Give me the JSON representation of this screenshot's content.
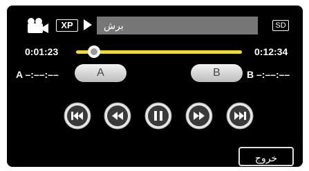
{
  "status": {
    "mode_icon": "video-camera-icon",
    "quality_badge": "XP",
    "play_icon": "play-icon",
    "title": "برش",
    "media_badge": "SD"
  },
  "timeline": {
    "current_time": "0:01:23",
    "total_time": "0:12:34",
    "progress_fraction": 0.11,
    "track_color": "#f2dd1e"
  },
  "ab": {
    "a_label": "A",
    "a_time": "–:––:––",
    "a_button": "A",
    "b_label": "B",
    "b_time": "–:––:––",
    "b_button": "B"
  },
  "controls": [
    {
      "icon": "skip-previous-icon"
    },
    {
      "icon": "rewind-icon"
    },
    {
      "icon": "pause-icon"
    },
    {
      "icon": "fast-forward-icon"
    },
    {
      "icon": "skip-next-icon"
    }
  ],
  "exit_button": "خروج"
}
